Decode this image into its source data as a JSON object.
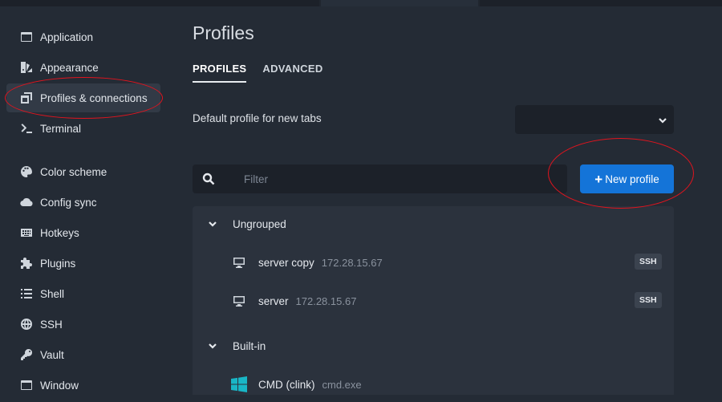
{
  "sidebar": {
    "items": [
      {
        "label": "Application",
        "icon": "application-icon"
      },
      {
        "label": "Appearance",
        "icon": "appearance-icon"
      },
      {
        "label": "Profiles & connections",
        "icon": "profiles-icon",
        "active": true
      },
      {
        "label": "Terminal",
        "icon": "terminal-icon"
      },
      {
        "label": "Color scheme",
        "icon": "palette-icon"
      },
      {
        "label": "Config sync",
        "icon": "cloud-icon"
      },
      {
        "label": "Hotkeys",
        "icon": "keyboard-icon"
      },
      {
        "label": "Plugins",
        "icon": "puzzle-icon"
      },
      {
        "label": "Shell",
        "icon": "list-icon"
      },
      {
        "label": "SSH",
        "icon": "globe-icon"
      },
      {
        "label": "Vault",
        "icon": "key-icon"
      },
      {
        "label": "Window",
        "icon": "window-icon"
      }
    ]
  },
  "main": {
    "title": "Profiles",
    "tabs": [
      {
        "label": "PROFILES",
        "active": true
      },
      {
        "label": "ADVANCED",
        "active": false
      }
    ],
    "default_profile": {
      "label": "Default profile for new tabs",
      "value": ""
    },
    "filter": {
      "placeholder": "Filter",
      "value": ""
    },
    "new_profile_button": {
      "plus": "+",
      "label": "New profile"
    },
    "groups": [
      {
        "name": "Ungrouped",
        "profiles": [
          {
            "name": "server copy",
            "description": "172.28.15.67",
            "badge": "SSH",
            "icon": "monitor-icon"
          },
          {
            "name": "server",
            "description": "172.28.15.67",
            "badge": "SSH",
            "icon": "monitor-icon"
          }
        ]
      },
      {
        "name": "Built-in",
        "profiles": [
          {
            "name": "CMD (clink)",
            "description": "cmd.exe",
            "badge": "",
            "icon": "windows-logo-icon"
          }
        ]
      }
    ]
  },
  "colors": {
    "background": "#242b35",
    "sidebar_active": "#323a46",
    "input_background": "#1c2129",
    "accent_button": "#1474d8",
    "annotation": "#e0141e",
    "windows_logo": "#19b6c6"
  }
}
